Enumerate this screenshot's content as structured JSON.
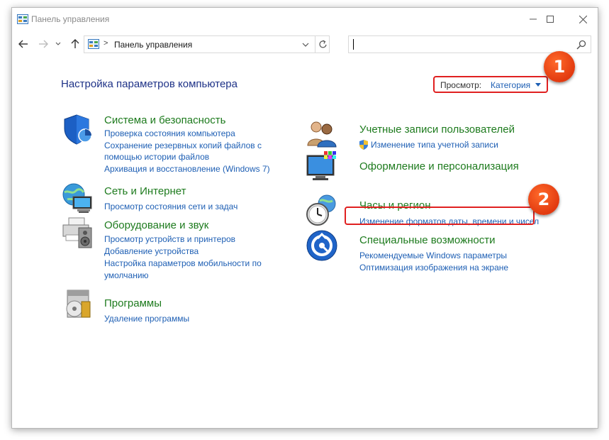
{
  "window": {
    "title": "Панель управления",
    "controls": {
      "minimize": "minimize-icon",
      "maximize": "maximize-icon",
      "close": "close-icon"
    }
  },
  "navigation": {
    "address_icon": "control-panel-icon",
    "address_separator": ">",
    "address_text": "Панель управления",
    "search_value": ""
  },
  "main": {
    "heading": "Настройка параметров компьютера",
    "view_label": "Просмотр:",
    "view_value": "Категория"
  },
  "categories": [
    {
      "title": "Система и безопасность",
      "icon": "shield-icon",
      "links": [
        "Проверка состояния компьютера",
        "Сохранение резервных копий файлов с",
        "помощью истории файлов",
        "Архивация и восстановление (Windows 7)"
      ]
    },
    {
      "title": "Сеть и Интернет",
      "icon": "network-globe-icon",
      "links": [
        "Просмотр состояния сети и задач"
      ]
    },
    {
      "title": "Оборудование и звук",
      "icon": "printer-speaker-icon",
      "links": [
        "Просмотр устройств и принтеров",
        "Добавление устройства",
        "Настройка параметров мобильности по",
        "умолчанию"
      ]
    },
    {
      "title": "Программы",
      "icon": "programs-disc-icon",
      "links": [
        "Удаление программы"
      ]
    },
    {
      "title": "Учетные записи пользователей",
      "icon": "users-icon",
      "links": [
        "Изменение типа учетной записи"
      ]
    },
    {
      "title": "Оформление и персонализация",
      "icon": "monitor-palette-icon",
      "links": []
    },
    {
      "title": "Часы и регион",
      "icon": "clock-globe-icon",
      "links": [
        "Изменение форматов даты, времени и чисел"
      ]
    },
    {
      "title": "Специальные возможности",
      "icon": "accessibility-icon",
      "links": [
        "Рекомендуемые Windows параметры",
        "Оптимизация изображения на экране"
      ]
    }
  ],
  "annotations": {
    "badge_1": "1",
    "badge_2": "2"
  },
  "colors": {
    "heading": "#1e3287",
    "category_title": "#1e7b1e",
    "link": "#1e5fb4",
    "highlight": "#e02020",
    "badge": "#e23a10"
  }
}
